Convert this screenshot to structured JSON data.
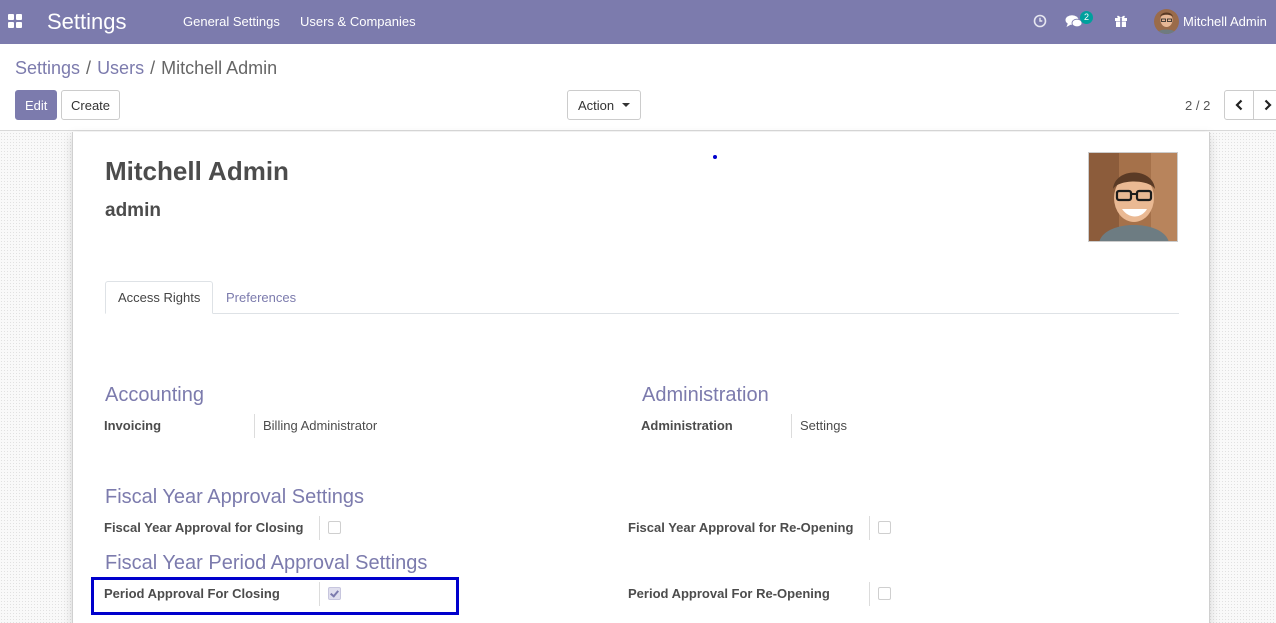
{
  "navbar": {
    "app_title": "Settings",
    "menus": [
      "General Settings",
      "Users & Companies"
    ],
    "chat_badge": "2",
    "user_name": "Mitchell Admin",
    "bg_color": "#7c7bad"
  },
  "breadcrumb": {
    "items": [
      "Settings",
      "Users",
      "Mitchell Admin"
    ],
    "separator": "/"
  },
  "toolbar": {
    "edit_label": "Edit",
    "create_label": "Create",
    "action_label": "Action",
    "pager": "2 / 2"
  },
  "record": {
    "name": "Mitchell Admin",
    "login": "admin"
  },
  "tabs": {
    "access_rights": "Access Rights",
    "preferences": "Preferences"
  },
  "sections": {
    "accounting": {
      "title": "Accounting",
      "invoicing_label": "Invoicing",
      "invoicing_value": "Billing Administrator"
    },
    "administration": {
      "title": "Administration",
      "admin_label": "Administration",
      "admin_value": "Settings"
    },
    "fiscal_year": {
      "title": "Fiscal Year Approval Settings",
      "closing_label": "Fiscal Year Approval for Closing",
      "closing_checked": false,
      "reopening_label": "Fiscal Year Approval for Re-Opening",
      "reopening_checked": false
    },
    "fiscal_period": {
      "title": "Fiscal Year Period Approval Settings",
      "closing_label": "Period Approval For Closing",
      "closing_checked": true,
      "reopening_label": "Period Approval For Re-Opening",
      "reopening_checked": false
    }
  }
}
